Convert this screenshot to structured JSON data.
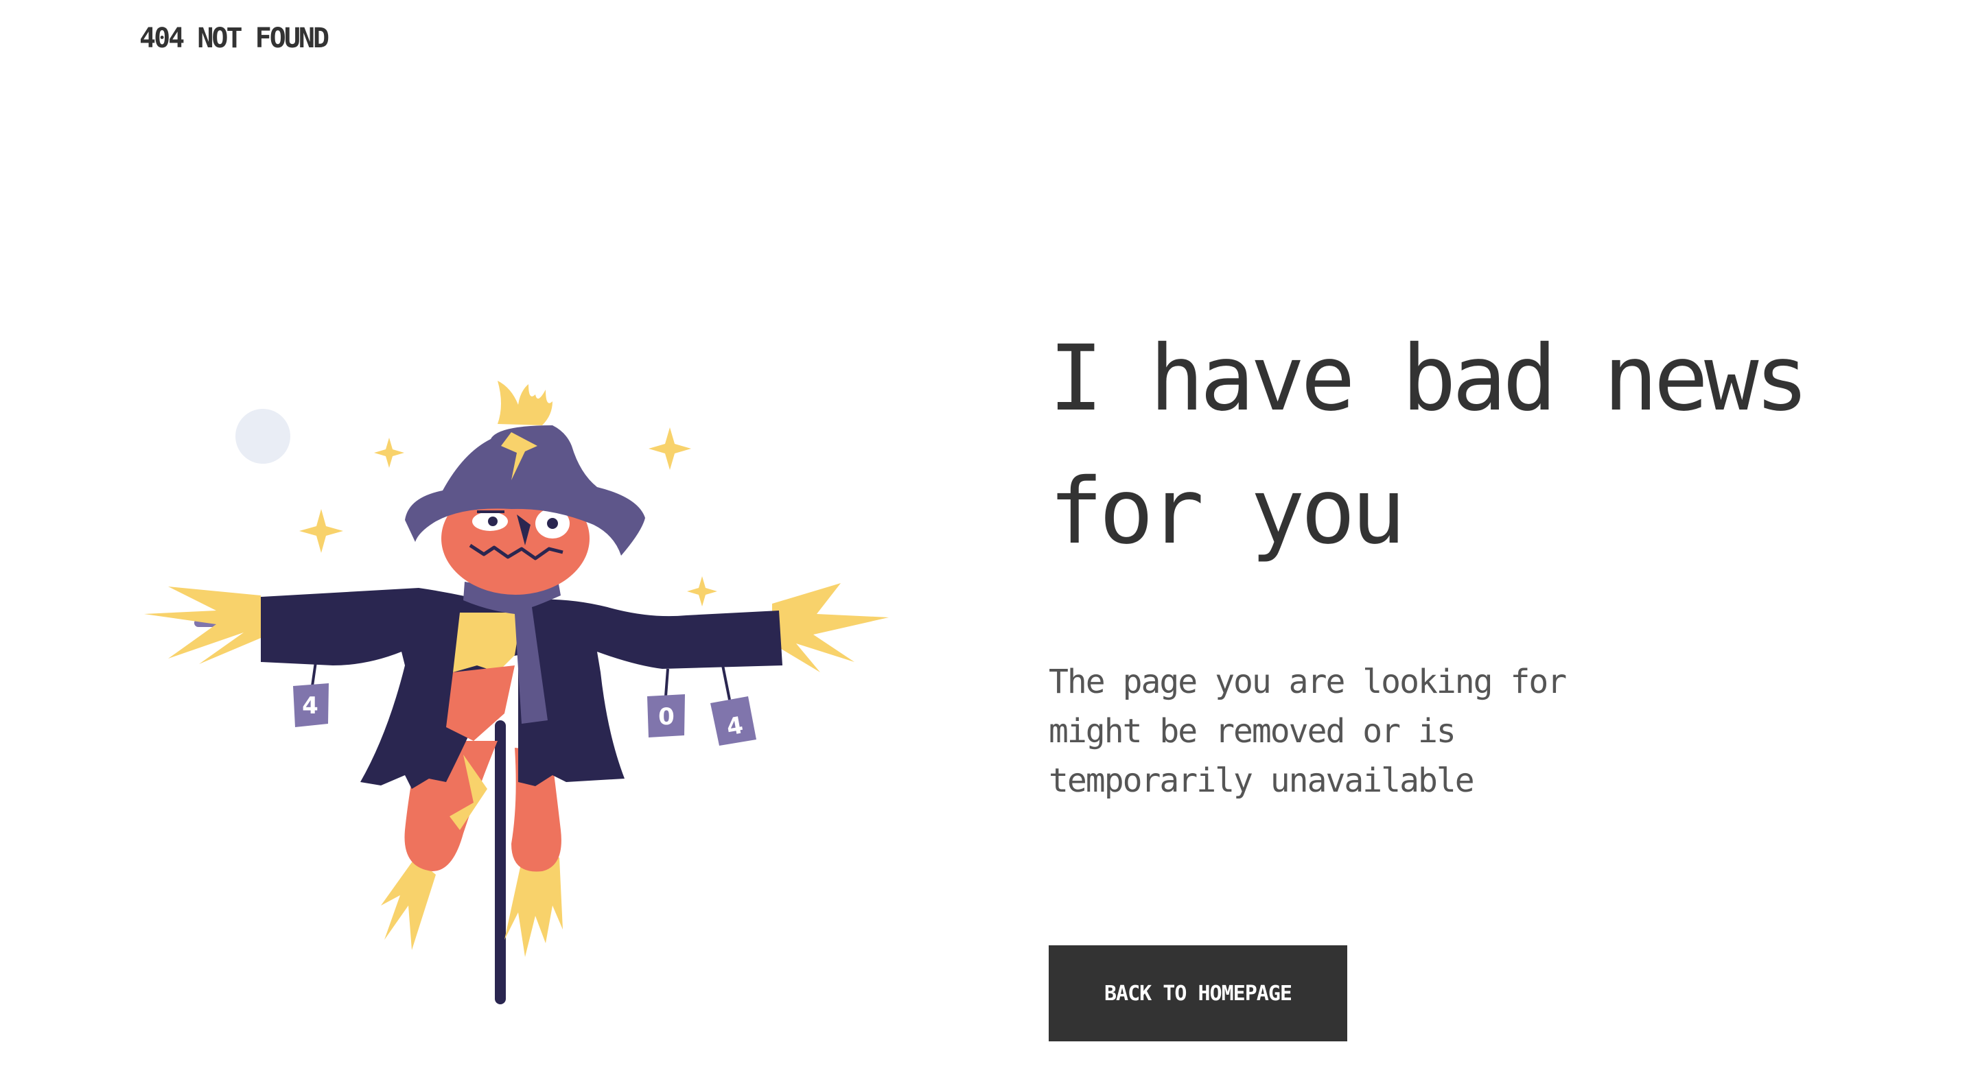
{
  "header": {
    "title": "404 NOT FOUND"
  },
  "main": {
    "headline": "I have bad news for you",
    "message": "The page you are looking for might be removed or is temporarily unavailable",
    "button_label": "BACK TO HOMEPAGE"
  },
  "illustration": {
    "subject": "scarecrow",
    "can_labels": [
      "4",
      "0",
      "4"
    ]
  },
  "colors": {
    "text": "#333333",
    "button_bg": "#333333",
    "button_text": "#ffffff",
    "hat": "#5e568a",
    "coat": "#2a2650",
    "face": "#ee735d",
    "straw": "#f8d26b",
    "moon": "#e9edf5",
    "can": "#8075ac"
  }
}
